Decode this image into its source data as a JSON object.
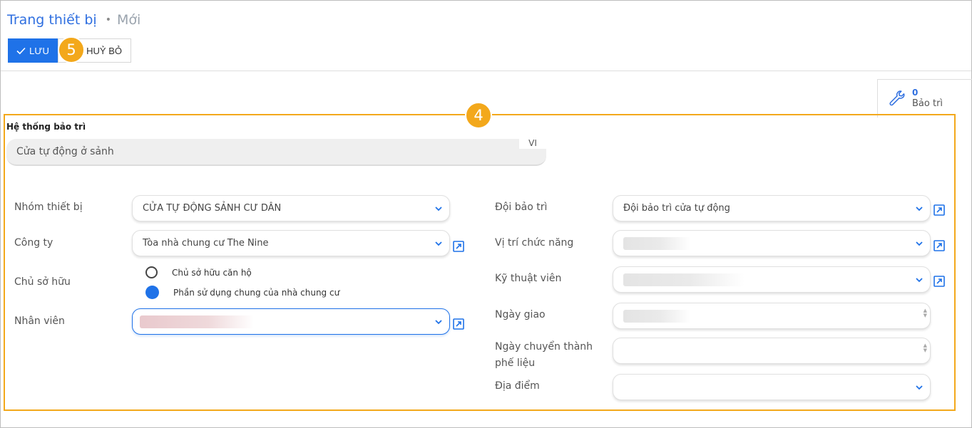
{
  "breadcrumb": {
    "parent": "Trang thiết bị",
    "separator": "•",
    "current": "Mới"
  },
  "toolbar": {
    "save_label": "LƯU",
    "cancel_label": "HUỶ BỎ"
  },
  "annotations": {
    "badge_save": "5",
    "badge_form": "4"
  },
  "smart_button": {
    "count": "0",
    "label": "Bảo trì",
    "icon": "wrench-icon"
  },
  "form": {
    "name_label": "Hệ thống bảo trì",
    "name_value": "Cửa tự động ở sảnh",
    "lang": "VI",
    "left": {
      "group_label": "Nhóm thiết bị",
      "group_value": "CỬA TỰ ĐỘNG SẢNH CƯ DÂN",
      "company_label": "Công ty",
      "company_value": "Tòa nhà chung cư The Nine",
      "owner_label": "Chủ sở hữu",
      "owner_options": [
        "Chủ sở hữu căn hộ",
        "Phần sử dụng chung của nhà chung cư"
      ],
      "owner_selected": 1,
      "employee_label": "Nhân viên"
    },
    "right": {
      "team_label": "Đội bảo trì",
      "team_value": "Đội bảo trì cửa tự động",
      "location_label": "Vị trí chức năng",
      "tech_label": "Kỹ thuật viên",
      "assign_date_label": "Ngày giao",
      "scrap_date_label": "Ngày chuyển thành phế liệu",
      "place_label": "Địa điểm"
    }
  },
  "colors": {
    "primary": "#1f72e8",
    "highlight": "#f3a81b",
    "link": "#2f6fe0"
  }
}
